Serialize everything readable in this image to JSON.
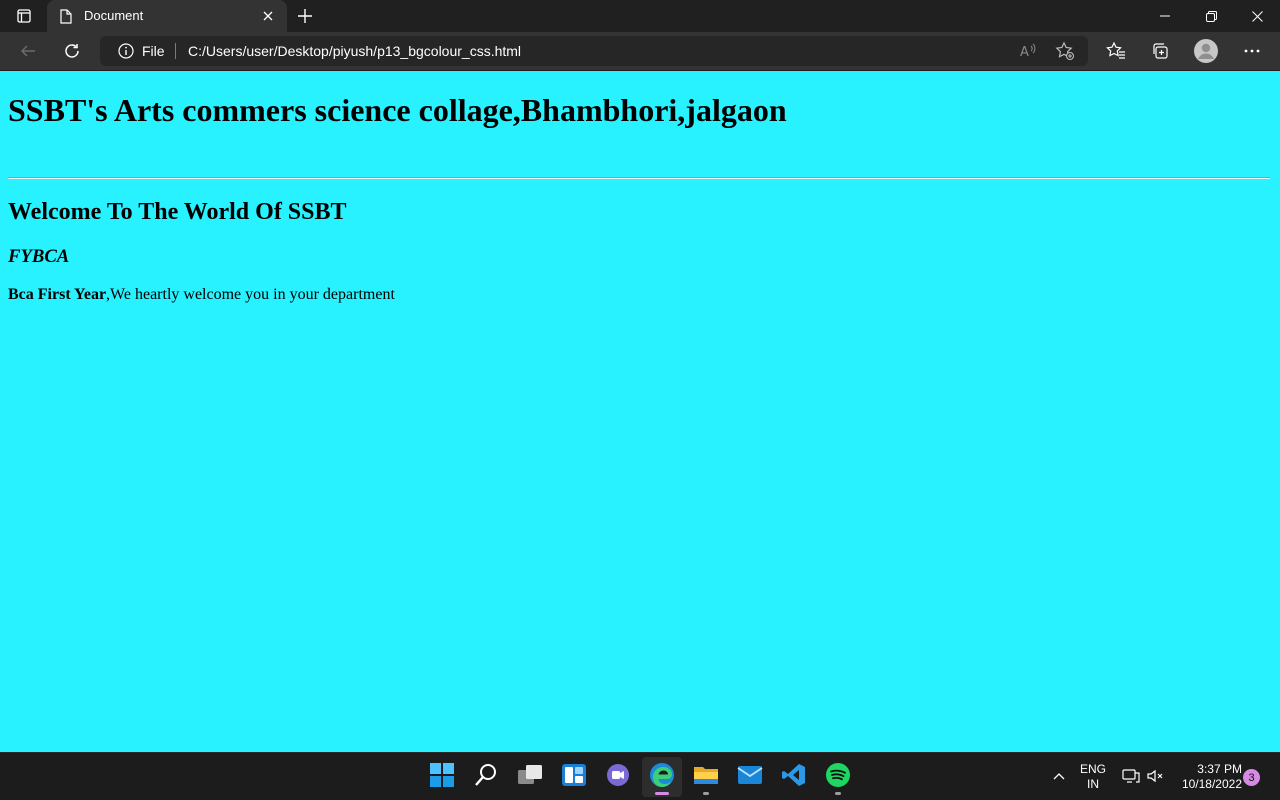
{
  "browser": {
    "tab": {
      "title": "Document"
    },
    "address": {
      "site_label": "File",
      "url": "C:/Users/user/Desktop/piyush/p13_bgcolour_css.html"
    }
  },
  "page": {
    "background_color": "#28f2ff",
    "heading1": "SSBT's Arts commers science collage,Bhambhori,jalgaon",
    "heading2": "Welcome To The World Of SSBT",
    "heading3": "FYBCA",
    "paragraph_bold": "Bca First Year",
    "paragraph_text": ",We heartly welcome you in your department"
  },
  "taskbar": {
    "apps": [
      "start-icon",
      "search-icon",
      "task-view-icon",
      "widgets-icon",
      "chat-icon",
      "edge-icon",
      "file-explorer-icon",
      "mail-icon",
      "vscode-icon",
      "spotify-icon"
    ],
    "active_app": "edge-icon",
    "tray": {
      "lang_line1": "ENG",
      "lang_line2": "IN",
      "time": "3:37 PM",
      "date": "10/18/2022",
      "notification_count": "3"
    }
  },
  "colors": {
    "accent": "#d58be6",
    "titlebar": "#202020",
    "toolbar": "#333333"
  }
}
